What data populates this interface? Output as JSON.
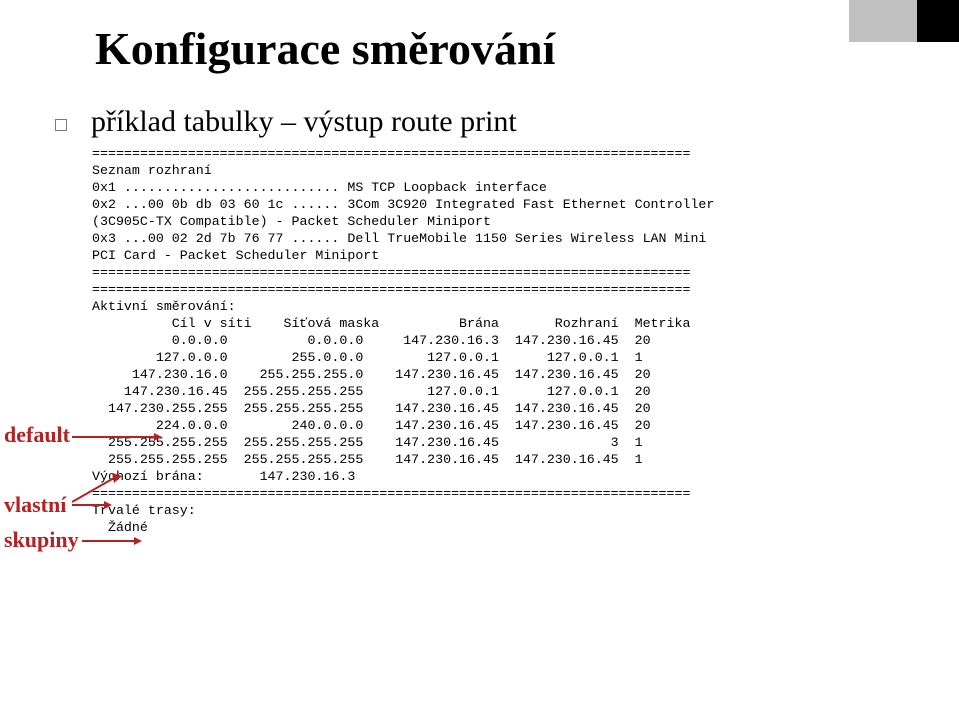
{
  "title": "Konfigurace směrování",
  "subtitle": "příklad tabulky – výstup route print",
  "labels": {
    "default": "default",
    "vlastni": "vlastní",
    "skupiny": "skupiny"
  },
  "route_text": "===========================================================================\nSeznam rozhraní\n0x1 ........................... MS TCP Loopback interface\n0x2 ...00 0b db 03 60 1c ...... 3Com 3C920 Integrated Fast Ethernet Controller\n(3C905C-TX Compatible) - Packet Scheduler Miniport\n0x3 ...00 02 2d 7b 76 77 ...... Dell TrueMobile 1150 Series Wireless LAN Mini\nPCI Card - Packet Scheduler Miniport\n===========================================================================\n===========================================================================\nAktivní směrování:\n          Cíl v síti    Síťová maska          Brána       Rozhraní  Metrika\n          0.0.0.0          0.0.0.0     147.230.16.3  147.230.16.45  20\n        127.0.0.0        255.0.0.0        127.0.0.1      127.0.0.1  1\n     147.230.16.0    255.255.255.0    147.230.16.45  147.230.16.45  20\n    147.230.16.45  255.255.255.255        127.0.0.1      127.0.0.1  20\n  147.230.255.255  255.255.255.255    147.230.16.45  147.230.16.45  20\n        224.0.0.0        240.0.0.0    147.230.16.45  147.230.16.45  20\n  255.255.255.255  255.255.255.255    147.230.16.45              3  1\n  255.255.255.255  255.255.255.255    147.230.16.45  147.230.16.45  1\nVýchozí brána:       147.230.16.3\n===========================================================================\nTrvalé trasy:\n  Žádné",
  "chart_data": {
    "type": "table",
    "title": "Aktivní směrování",
    "columns": [
      "Cíl v síti",
      "Síťová maska",
      "Brána",
      "Rozhraní",
      "Metrika"
    ],
    "rows": [
      [
        "0.0.0.0",
        "0.0.0.0",
        "147.230.16.3",
        "147.230.16.45",
        "20"
      ],
      [
        "127.0.0.0",
        "255.0.0.0",
        "127.0.0.1",
        "127.0.0.1",
        "1"
      ],
      [
        "147.230.16.0",
        "255.255.255.0",
        "147.230.16.45",
        "147.230.16.45",
        "20"
      ],
      [
        "147.230.16.45",
        "255.255.255.255",
        "127.0.0.1",
        "127.0.0.1",
        "20"
      ],
      [
        "147.230.255.255",
        "255.255.255.255",
        "147.230.16.45",
        "147.230.16.45",
        "20"
      ],
      [
        "224.0.0.0",
        "240.0.0.0",
        "147.230.16.45",
        "147.230.16.45",
        "20"
      ],
      [
        "255.255.255.255",
        "255.255.255.255",
        "147.230.16.45",
        "3",
        "1"
      ],
      [
        "255.255.255.255",
        "255.255.255.255",
        "147.230.16.45",
        "147.230.16.45",
        "1"
      ]
    ],
    "default_gateway": "147.230.16.3",
    "interfaces": [
      {
        "id": "0x1",
        "desc": "MS TCP Loopback interface"
      },
      {
        "id": "0x2",
        "mac": "00 0b db 03 60 1c",
        "desc": "3Com 3C920 Integrated Fast Ethernet Controller (3C905C-TX Compatible) - Packet Scheduler Miniport"
      },
      {
        "id": "0x3",
        "mac": "00 02 2d 7b 76 77",
        "desc": "Dell TrueMobile 1150 Series Wireless LAN Mini PCI Card - Packet Scheduler Miniport"
      }
    ],
    "persistent_routes": "Žádné"
  },
  "colors": {
    "label": "#b22222"
  }
}
